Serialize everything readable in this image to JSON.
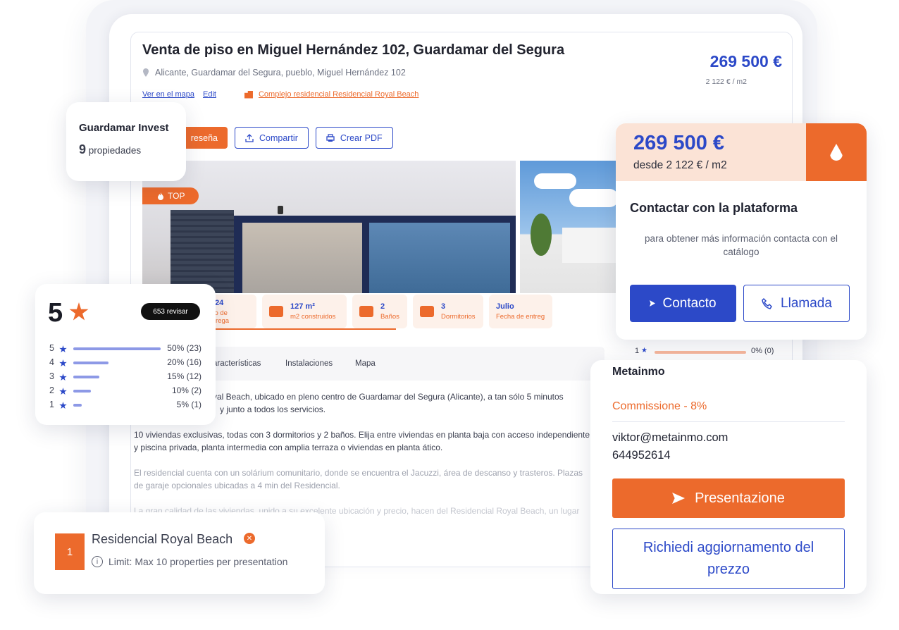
{
  "listing": {
    "title": "Venta de piso en Miguel Hernández 102, Guardamar del Segura",
    "address": "Alicante, Guardamar del Segura, pueblo, Miguel Hernández 102",
    "link_map": "Ver en el mapa",
    "link_edit": "Edit",
    "link_complex": "Complejo residencial Residencial Royal Beach",
    "price": "269 500 €",
    "price_per_m2": "2 122 € / m2",
    "btn_review": "reseña",
    "btn_share": "Compartir",
    "btn_pdf": "Crear PDF",
    "badge_top": "TOP",
    "features": [
      {
        "value": "2024",
        "label": "Año de entrega"
      },
      {
        "value": "127 m²",
        "label": "m2 construidos"
      },
      {
        "value": "2",
        "label": "Baños"
      },
      {
        "value": "3",
        "label": "Dormitorios"
      },
      {
        "value": "Julio",
        "label": "Fecha de entreg"
      }
    ],
    "tabs": [
      "aracterísticas",
      "Instalaciones",
      "Mapa"
    ],
    "desc_1": "yal Beach, ubicado en pleno centro de Guardamar del Segura (Alicante), a tan sólo 5 minutos",
    "desc_1b": "y junto a todos los servicios.",
    "desc_2": "10 viviendas exclusivas, todas con 3 dormitorios y 2 baños. Elija entre viviendas en planta baja con acceso independiente y piscina privada, planta intermedia con amplia terraza o viviendas en planta ático.",
    "desc_3": "El residencial cuenta con un solárium comunitario, donde se encuentra el Jacuzzi, área de descanso y trasteros. Plazas de garaje opcionales ubicadas a 4 min del Residencial.",
    "desc_4": "La gran calidad de las viviendas, unido a su excelente ubicación y precio, hacen del Residencial Royal Beach, un lugar"
  },
  "invest": {
    "name": "Guardamar Invest",
    "count": "9",
    "label": "propiedades"
  },
  "rating": {
    "score": "5",
    "reviews": "653 revisar",
    "rows": [
      {
        "n": "5",
        "pct": "50%",
        "cnt": "(23)",
        "fraction": 0.5
      },
      {
        "n": "4",
        "pct": "20%",
        "cnt": "(16)",
        "fraction": 0.2
      },
      {
        "n": "3",
        "pct": "15%",
        "cnt": "(12)",
        "fraction": 0.15
      },
      {
        "n": "2",
        "pct": "10%",
        "cnt": "(2)",
        "fraction": 0.1
      },
      {
        "n": "1",
        "pct": "5%",
        "cnt": "(1)",
        "fraction": 0.05
      }
    ],
    "row1_label": "1",
    "row1_pct": "0% (0)"
  },
  "royal": {
    "index": "1",
    "name": "Residencial Royal Beach",
    "limit": "Limit: Max 10 properties per presentation"
  },
  "contact": {
    "price": "269 500 €",
    "from": "desde 2 122 € / m2",
    "title": "Contactar con la plataforma",
    "subtitle": "para obtener más información contacta con el catálogo",
    "btn_contact": "Contacto",
    "btn_call": "Llamada"
  },
  "meta": {
    "name": "Metainmo",
    "commission": "Commissione - 8%",
    "email": "viktor@metainmo.com",
    "phone": "644952614",
    "btn_presentation": "Presentazione",
    "btn_update": "Richiedi aggiornamento del prezzo"
  },
  "colors": {
    "accent_blue": "#2c49c8",
    "accent_orange": "#ec6a2c"
  }
}
